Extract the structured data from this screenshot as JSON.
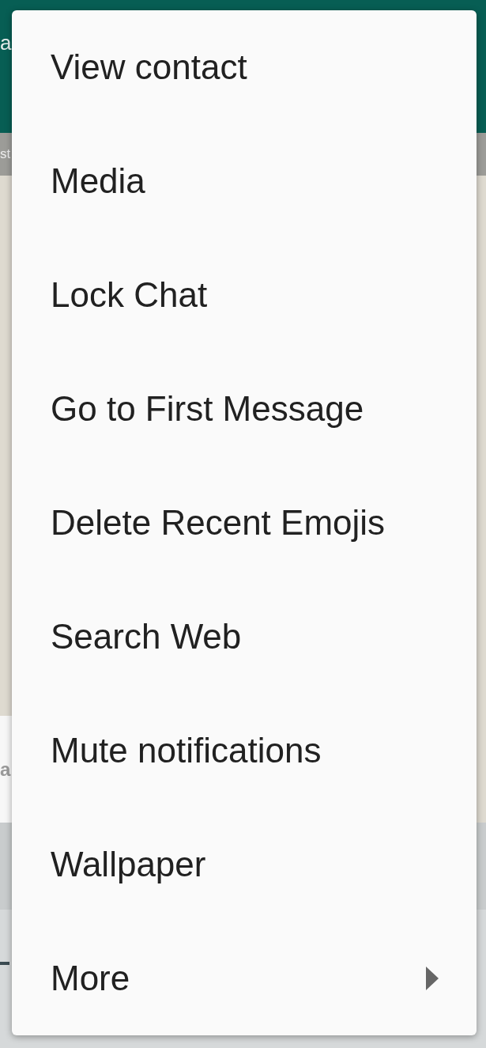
{
  "background": {
    "header_title": "a",
    "date_chip": "st",
    "message": "a"
  },
  "menu": {
    "items": [
      {
        "label": "View contact",
        "kind": "action"
      },
      {
        "label": "Media",
        "kind": "action"
      },
      {
        "label": "Lock Chat",
        "kind": "action"
      },
      {
        "label": "Go to First Message",
        "kind": "action"
      },
      {
        "label": "Delete Recent Emojis",
        "kind": "action"
      },
      {
        "label": "Search Web",
        "kind": "action"
      },
      {
        "label": "Mute notifications",
        "kind": "action"
      },
      {
        "label": "Wallpaper",
        "kind": "action"
      },
      {
        "label": "More",
        "kind": "submenu"
      }
    ]
  }
}
